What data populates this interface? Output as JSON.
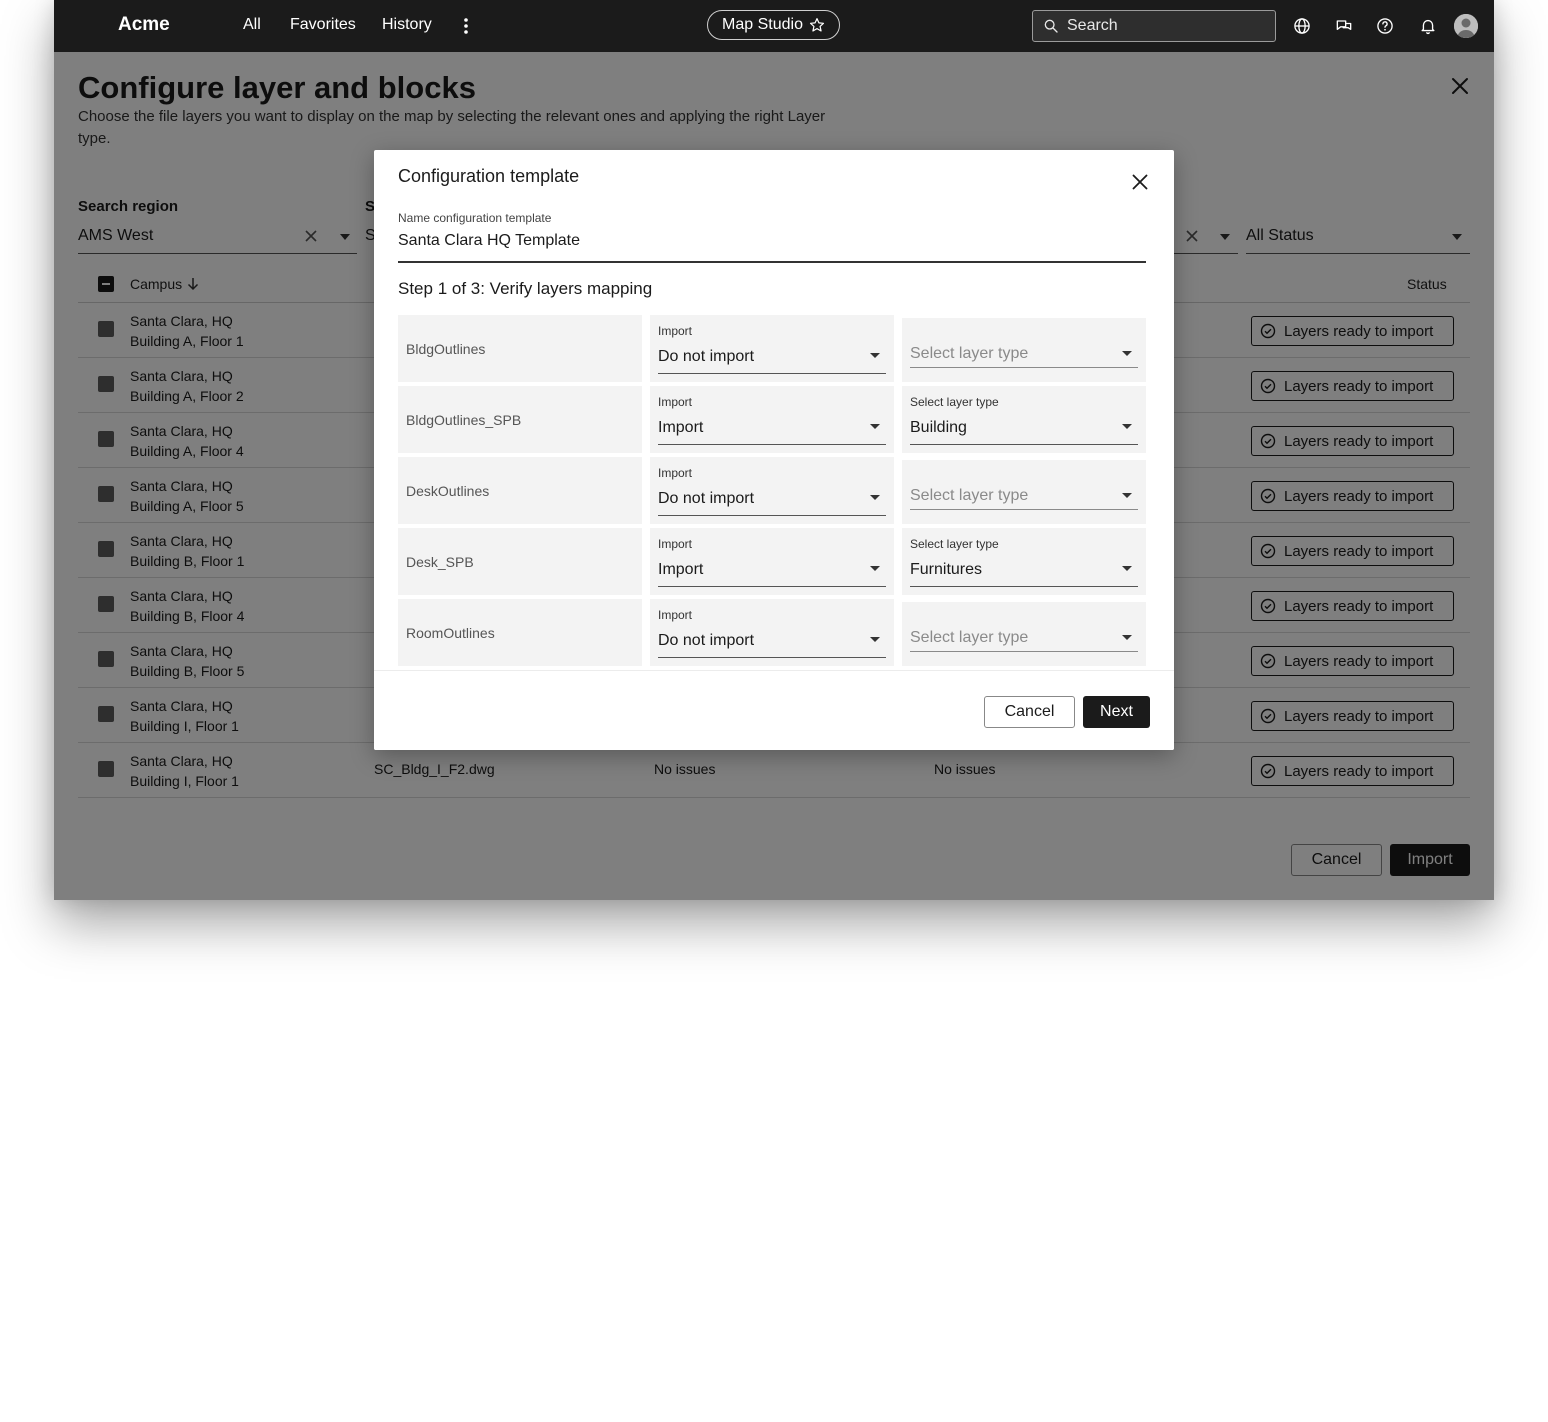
{
  "topbar": {
    "brand": "Acme",
    "nav": [
      "All",
      "Favorites",
      "History"
    ],
    "app_pill": "Map Studio",
    "search_placeholder": "Search"
  },
  "page": {
    "title": "Configure layer and blocks",
    "description": "Choose the file layers you want to display on the map by selecting the relevant ones and applying the right Layer type.",
    "filters": {
      "region_label": "Search region",
      "region_value": "AMS West",
      "second_label_partial": "S",
      "second_value_partial": "S",
      "status_value": "All Status"
    },
    "table": {
      "col_campus": "Campus",
      "col_status": "Status",
      "rows": [
        {
          "campus": "Santa Clara, HQ",
          "floor": "Building A, Floor 1",
          "status": "Layers ready to import"
        },
        {
          "campus": "Santa Clara, HQ",
          "floor": "Building A, Floor 2",
          "status": "Layers ready to import"
        },
        {
          "campus": "Santa Clara, HQ",
          "floor": "Building A, Floor 4",
          "status": "Layers ready to import"
        },
        {
          "campus": "Santa Clara, HQ",
          "floor": "Building A, Floor 5",
          "status": "Layers ready to import"
        },
        {
          "campus": "Santa Clara, HQ",
          "floor": "Building B, Floor 1",
          "status": "Layers ready to import"
        },
        {
          "campus": "Santa Clara, HQ",
          "floor": "Building B, Floor 4",
          "status": "Layers ready to import"
        },
        {
          "campus": "Santa Clara, HQ",
          "floor": "Building B, Floor 5",
          "status": "Layers ready to import"
        },
        {
          "campus": "Santa Clara, HQ",
          "floor": "Building I, Floor 1",
          "status": "Layers ready to import"
        },
        {
          "campus": "Santa Clara, HQ",
          "floor": "Building I, Floor 1",
          "status": "Layers ready to import",
          "file": "SC_Bldg_I_F2.dwg",
          "issues_a": "No issues",
          "issues_b": "No issues"
        }
      ]
    },
    "footer": {
      "cancel": "Cancel",
      "import": "Import"
    }
  },
  "modal": {
    "title": "Configuration template",
    "name_label": "Name configuration template",
    "name_value": "Santa Clara HQ Template",
    "step": "Step 1 of 3: Verify layers mapping",
    "import_label": "Import",
    "type_label": "Select layer type",
    "layers": [
      {
        "name": "BldgOutlines",
        "import": "Do not import",
        "type": ""
      },
      {
        "name": "BldgOutlines_SPB",
        "import": "Import",
        "type": "Building"
      },
      {
        "name": "DeskOutlines",
        "import": "Do not import",
        "type": ""
      },
      {
        "name": "Desk_SPB",
        "import": "Import",
        "type": "Furnitures"
      },
      {
        "name": "RoomOutlines",
        "import": "Do not import",
        "type": ""
      }
    ],
    "cancel": "Cancel",
    "next": "Next"
  },
  "colors": {
    "topbar_bg": "#1b1b1b",
    "primary_button": "#1b1b1b",
    "overlay": "rgba(0,0,0,0.5)"
  }
}
